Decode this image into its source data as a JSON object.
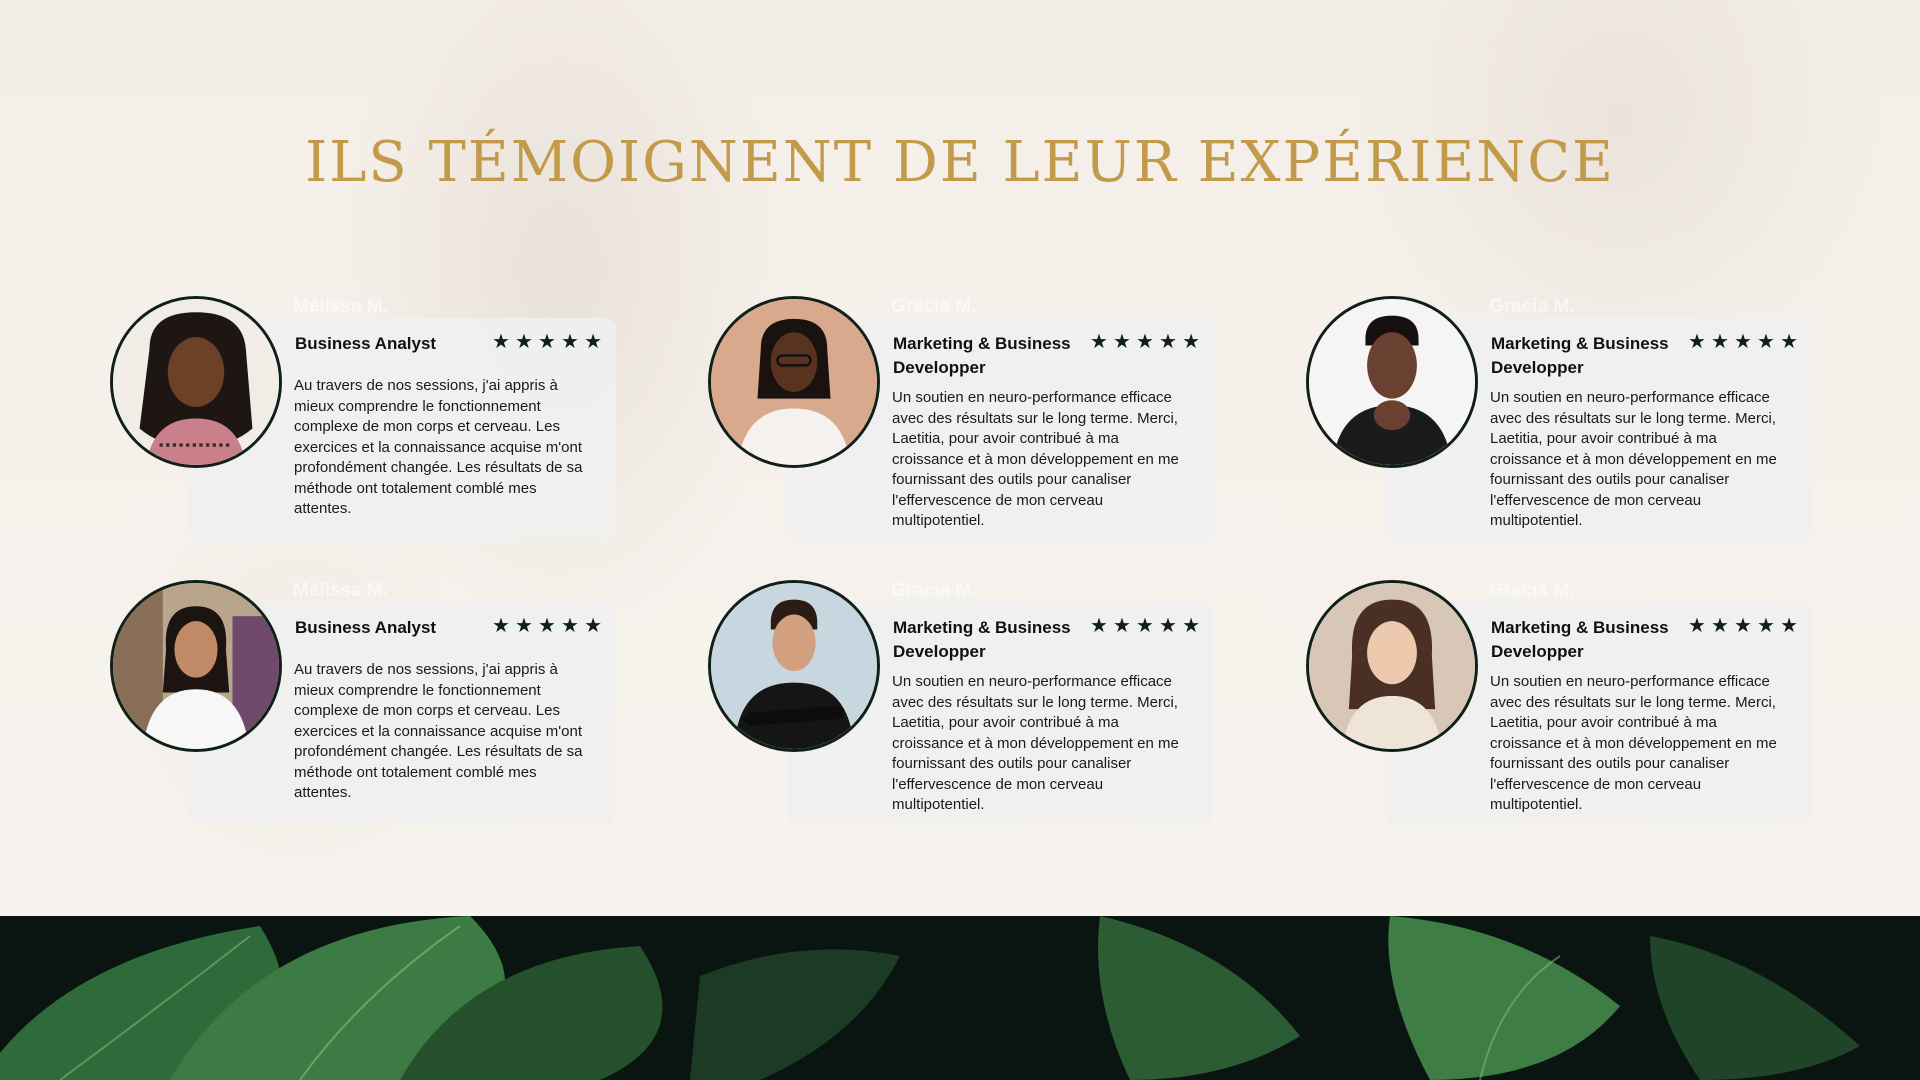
{
  "title": "ILS TÉMOIGNENT DE LEUR EXPÉRIENCE",
  "stars_glyph": "★",
  "colors": {
    "title": "#c39a4a",
    "star": "#0f1f19",
    "avatar_border": "#0f2018",
    "card_bg": "#f0f0f0"
  },
  "testimonials": [
    {
      "name": "Mélissa M.",
      "role": "Business Analyst",
      "rating": 5,
      "text": "Au travers de nos sessions, j'ai appris à mieux comprendre le fonctionnement complexe de mon corps et cerveau. Les exercices et la connaissance acquise m'ont profondément changée. Les résultats de sa méthode ont totalement comblé mes attentes."
    },
    {
      "name": "Gracia M.",
      "role": "Marketing & Business Developper",
      "rating": 5,
      "text": "Un soutien en neuro-performance efficace avec des résultats sur le long terme. Merci, Laetitia, pour avoir contribué à ma croissance et à mon développement en me fournissant des outils pour canaliser l'effervescence de mon cerveau multipotentiel."
    },
    {
      "name": "Gracia M.",
      "role": "Marketing & Business Developper",
      "rating": 5,
      "text": "Un soutien en neuro-performance efficace avec des résultats sur le long terme. Merci, Laetitia, pour avoir contribué à ma croissance et à mon développement en me fournissant des outils pour canaliser l'effervescence de mon cerveau multipotentiel."
    },
    {
      "name": "Mélissa M.",
      "role": "Business Analyst",
      "rating": 5,
      "text": "Au travers de nos sessions, j'ai appris à mieux comprendre le fonctionnement complexe de mon corps et cerveau. Les exercices et la connaissance acquise m'ont profondément changée. Les résultats de sa méthode ont totalement comblé mes attentes."
    },
    {
      "name": "Gracia M.",
      "role": "Marketing & Business Developper",
      "rating": 5,
      "text": "Un soutien en neuro-performance efficace avec des résultats sur le long terme. Merci, Laetitia, pour avoir contribué à ma croissance et à mon développement en me fournissant des outils pour canaliser l'effervescence de mon cerveau multipotentiel."
    },
    {
      "name": "Gracia M.",
      "role": "Marketing & Business Developper",
      "rating": 5,
      "text": "Un soutien en neuro-performance efficace avec des résultats sur le long terme. Merci, Laetitia, pour avoir contribué à ma croissance et à mon développement en me fournissant des outils pour canaliser l'effervescence de mon cerveau multipotentiel."
    }
  ]
}
